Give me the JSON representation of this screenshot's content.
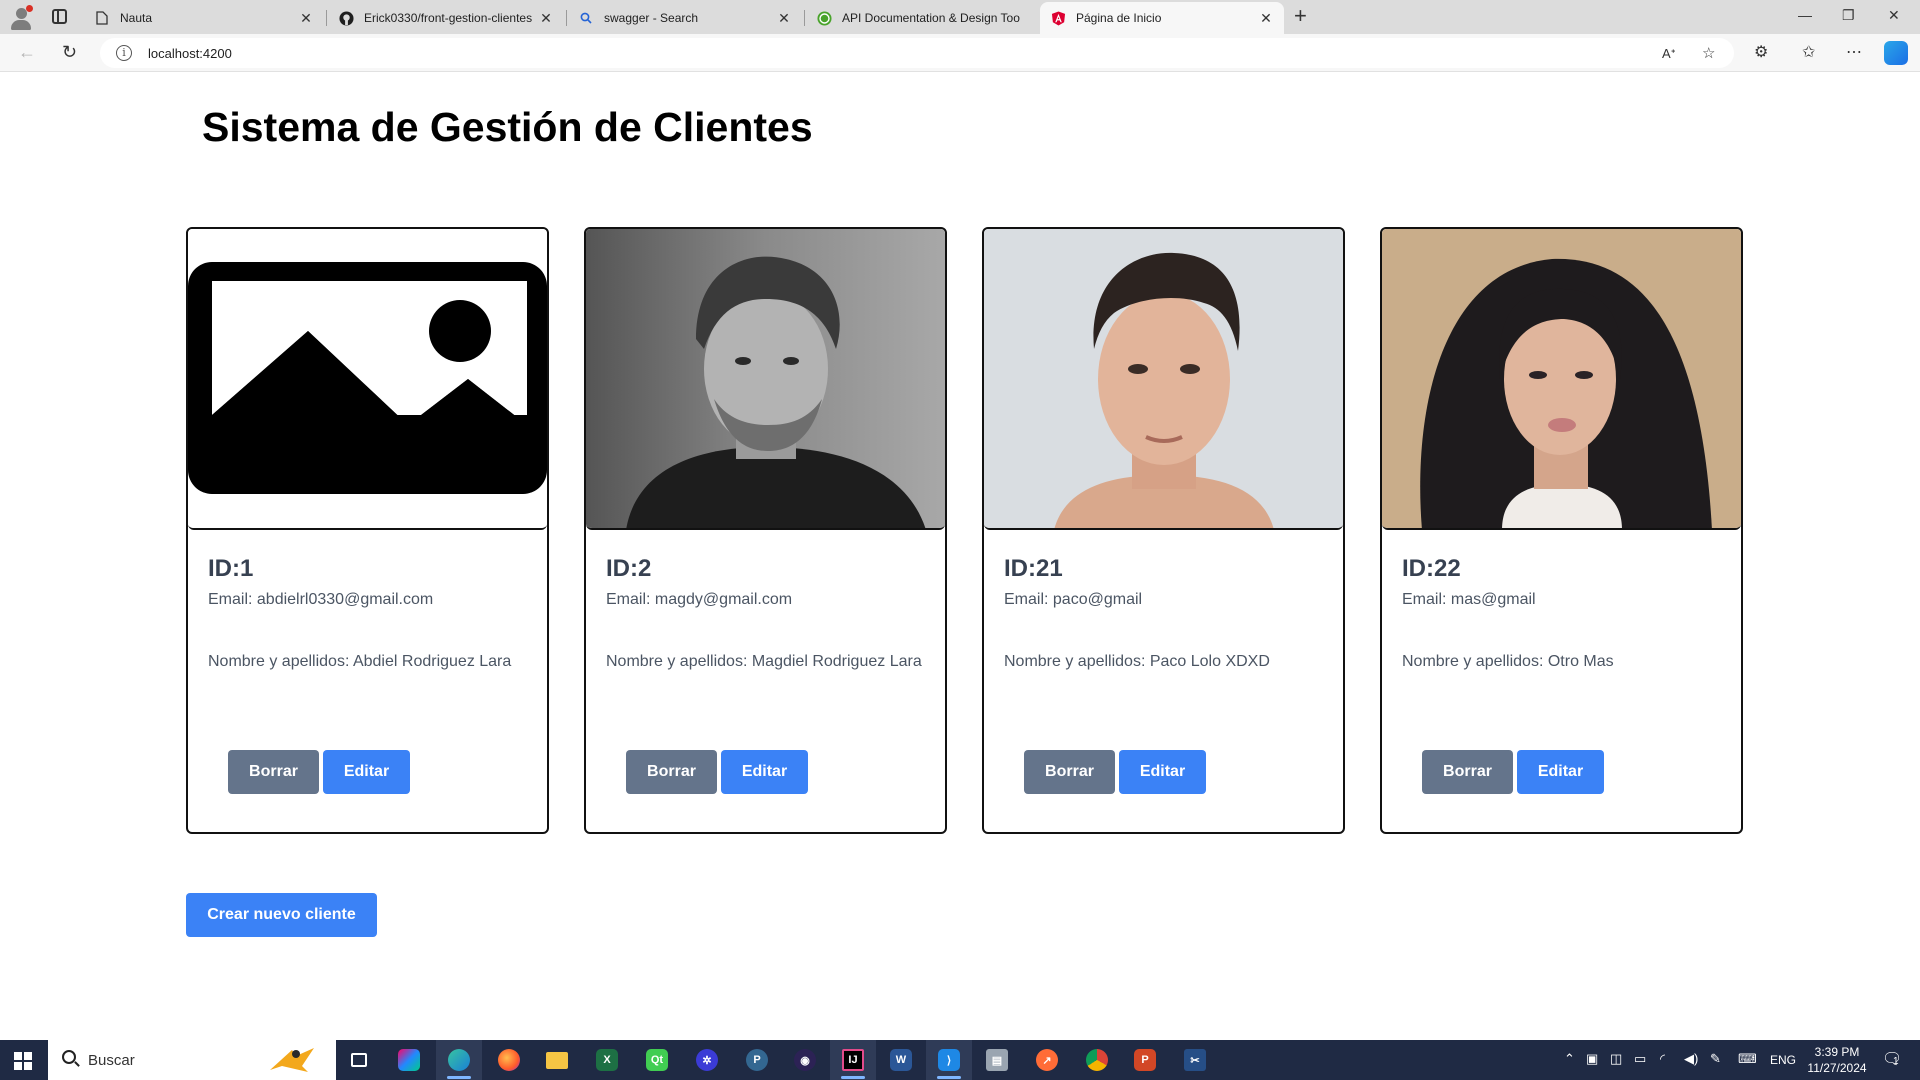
{
  "browser": {
    "tabs": [
      {
        "title": "Nauta",
        "icon": "document-icon"
      },
      {
        "title": "Erick0330/front-gestion-clientes",
        "icon": "github-icon"
      },
      {
        "title": "swagger - Search",
        "icon": "search-icon"
      },
      {
        "title": "API Documentation & Design Too",
        "icon": "swagger-icon"
      },
      {
        "title": "Página de Inicio",
        "icon": "angular-icon"
      }
    ],
    "url": "localhost:4200"
  },
  "page": {
    "title": "Sistema de Gestión de Clientes",
    "clients": [
      {
        "id_label": "ID:1",
        "email": "Email: abdielrl0330@gmail.com",
        "name": "Nombre y apellidos: Abdiel Rodriguez Lara",
        "photo": "placeholder-image"
      },
      {
        "id_label": "ID:2",
        "email": "Email: magdy@gmail.com",
        "name": "Nombre y apellidos: Magdiel Rodriguez Lara",
        "photo": "man-grayscale-photo"
      },
      {
        "id_label": "ID:21",
        "email": "Email: paco@gmail",
        "name": "Nombre y apellidos: Paco Lolo XDXD",
        "photo": "man-color-photo"
      },
      {
        "id_label": "ID:22",
        "email": "Email: mas@gmail",
        "name": "Nombre y apellidos: Otro Mas",
        "photo": "woman-color-photo"
      }
    ],
    "delete_label": "Borrar",
    "edit_label": "Editar",
    "create_label": "Crear nuevo cliente"
  },
  "taskbar": {
    "search_placeholder": "Buscar",
    "language": "ENG",
    "time": "3:39 PM",
    "date": "11/27/2024",
    "notification_count": "1"
  },
  "colors": {
    "accent": "#3b82f6",
    "secondary": "#64748b",
    "text_dark": "#374151",
    "text_muted": "#4b5563"
  }
}
